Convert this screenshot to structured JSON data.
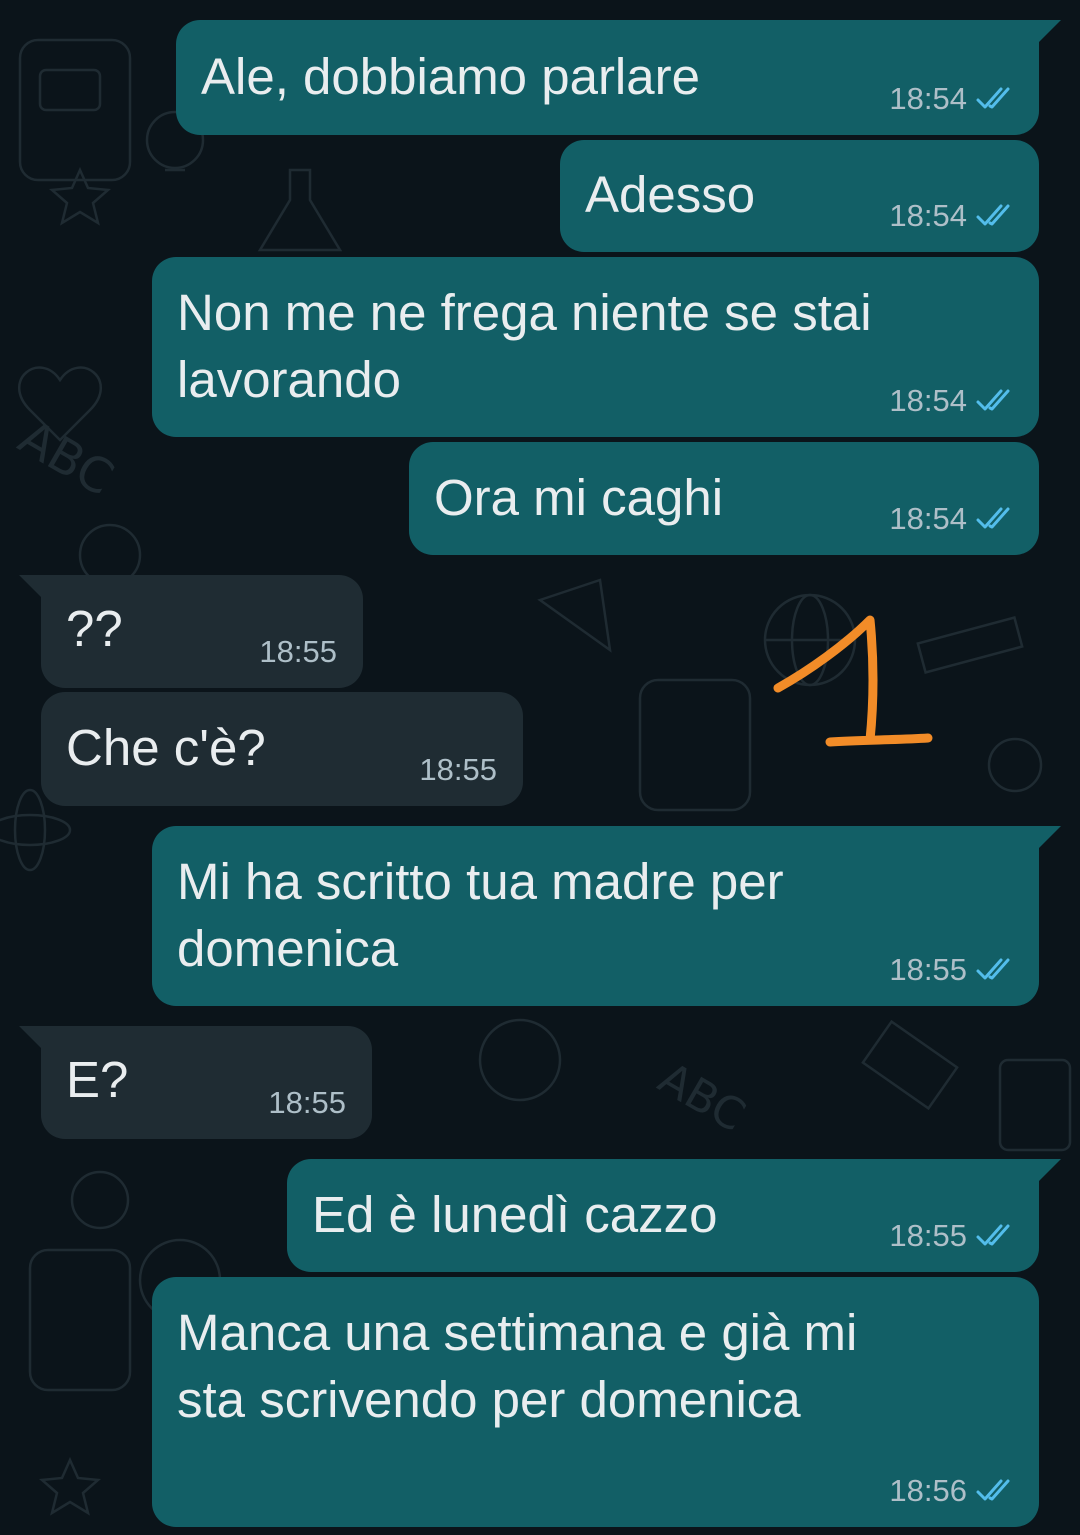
{
  "colors": {
    "background": "#0b141a",
    "outgoing_bubble": "#125f66",
    "incoming_bubble": "#1f2c33",
    "message_text": "#e9edef",
    "timestamp": "#aebfc8",
    "read_check": "#53bdeb",
    "annotation": "#f28c28"
  },
  "annotation": {
    "text": "1",
    "icon": "hand-drawn-number-one"
  },
  "messages": [
    {
      "direction": "outgoing",
      "text": "Ale, dobbiamo parlare",
      "time": "18:54",
      "status": "read"
    },
    {
      "direction": "outgoing",
      "text": "Adesso",
      "time": "18:54",
      "status": "read"
    },
    {
      "direction": "outgoing",
      "text": "Non me ne frega niente se stai\nlavorando",
      "time": "18:54",
      "status": "read"
    },
    {
      "direction": "outgoing",
      "text": "Ora mi caghi",
      "time": "18:54",
      "status": "read"
    },
    {
      "direction": "incoming",
      "text": "??",
      "time": "18:55"
    },
    {
      "direction": "incoming",
      "text": "Che c'è?",
      "time": "18:55"
    },
    {
      "direction": "outgoing",
      "text": "Mi ha scritto tua madre per\ndomenica",
      "time": "18:55",
      "status": "read"
    },
    {
      "direction": "incoming",
      "text": "E?",
      "time": "18:55"
    },
    {
      "direction": "outgoing",
      "text": "Ed è lunedì cazzo",
      "time": "18:55",
      "status": "read"
    },
    {
      "direction": "outgoing",
      "text": "Manca una settimana e già mi\nsta scrivendo per domenica",
      "time": "18:56",
      "status": "read"
    }
  ]
}
